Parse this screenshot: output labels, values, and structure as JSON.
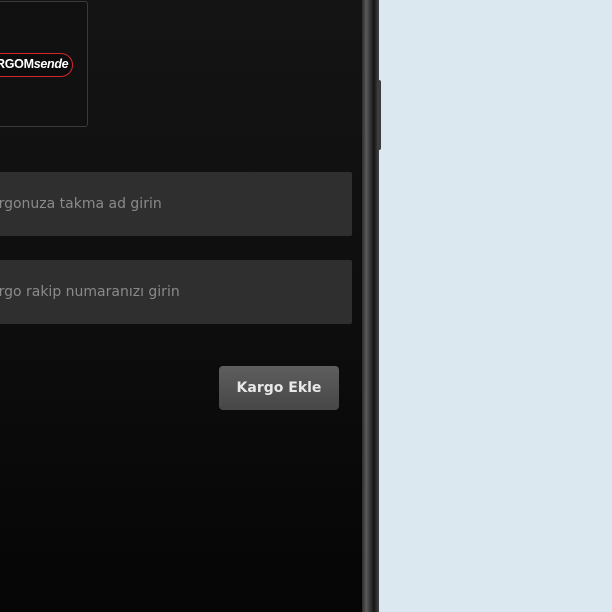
{
  "logo": {
    "text_main": "RGOM",
    "text_em": "sende"
  },
  "form": {
    "nickname_placeholder": "argonuza takma ad girin",
    "tracking_placeholder": "argo rakip numaranızı girin",
    "nickname_value": "",
    "tracking_value": ""
  },
  "actions": {
    "add_label": "Kargo Ekle"
  },
  "colors": {
    "screen_bg": "#101010",
    "field_bg": "#2f2f2f",
    "button_bg": "#535353",
    "logo_accent": "#d7262b",
    "outside_bg": "#dce8ef"
  }
}
